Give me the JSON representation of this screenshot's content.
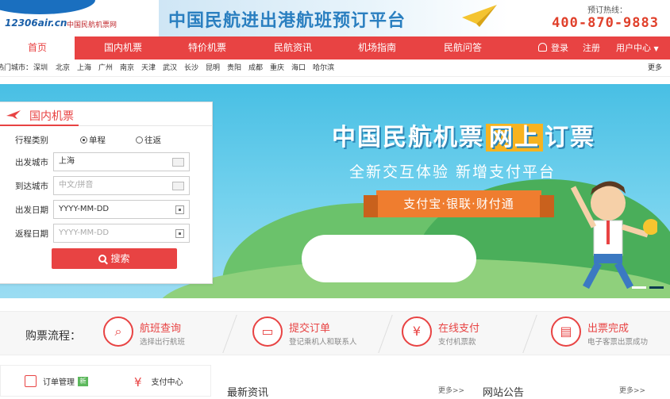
{
  "header": {
    "logo_text": "12306air.cn",
    "logo_sub": "中国民航机票网",
    "slogan": "中国民航进出港航班预订平台",
    "hotline_label": "预订热线：",
    "hotline_number": "400-870-9883"
  },
  "nav": {
    "items": [
      {
        "label": "首页",
        "active": true
      },
      {
        "label": "国内机票"
      },
      {
        "label": "特价机票"
      },
      {
        "label": "民航资讯"
      },
      {
        "label": "机场指南"
      },
      {
        "label": "民航问答"
      }
    ],
    "login": "登录",
    "register": "注册",
    "user_center": "用户中心"
  },
  "hot_cities": {
    "label": "热门城市：",
    "cities": [
      "深圳",
      "北京",
      "上海",
      "广州",
      "南京",
      "天津",
      "武汉",
      "长沙",
      "昆明",
      "贵阳",
      "成都",
      "重庆",
      "海口",
      "哈尔滨"
    ],
    "more": "更多"
  },
  "banner": {
    "title_a": "中国民航机票",
    "title_hl": "网上",
    "title_b": "订票",
    "subtitle": "全新交互体验  新增支付平台",
    "ribbon": "支付宝·银联·财付通"
  },
  "search": {
    "title": "国内机票",
    "trip_type_label": "行程类别",
    "one_way": "单程",
    "round_trip": "往返",
    "depart_city_label": "出发城市",
    "depart_city_value": "上海",
    "arrive_city_label": "到达城市",
    "arrive_city_placeholder": "中文/拼音",
    "depart_date_label": "出发日期",
    "depart_date_value": "YYYY-MM-DD",
    "return_date_label": "返程日期",
    "return_date_placeholder": "YYYY-MM-DD",
    "button": "搜索"
  },
  "process": {
    "title": "购票流程：",
    "steps": [
      {
        "title": "航班查询",
        "desc": "选择出行航班",
        "icon": "search-icon"
      },
      {
        "title": "提交订单",
        "desc": "登记乘机人和联系人",
        "icon": "monitor-icon"
      },
      {
        "title": "在线支付",
        "desc": "支付机票款",
        "icon": "yen-icon"
      },
      {
        "title": "出票完成",
        "desc": "电子客票出票成功",
        "icon": "ticket-icon"
      }
    ]
  },
  "bottom": {
    "order_manage": "订单管理",
    "new_badge": "新",
    "pay_center": "支付中心",
    "news_title": "最新资讯",
    "news_more": "更多>>",
    "notice_title": "网站公告",
    "notice_more": "更多>>"
  },
  "colors": {
    "brand_red": "#e84343",
    "brand_blue": "#1a6fbf",
    "hotline": "#e0402b"
  }
}
